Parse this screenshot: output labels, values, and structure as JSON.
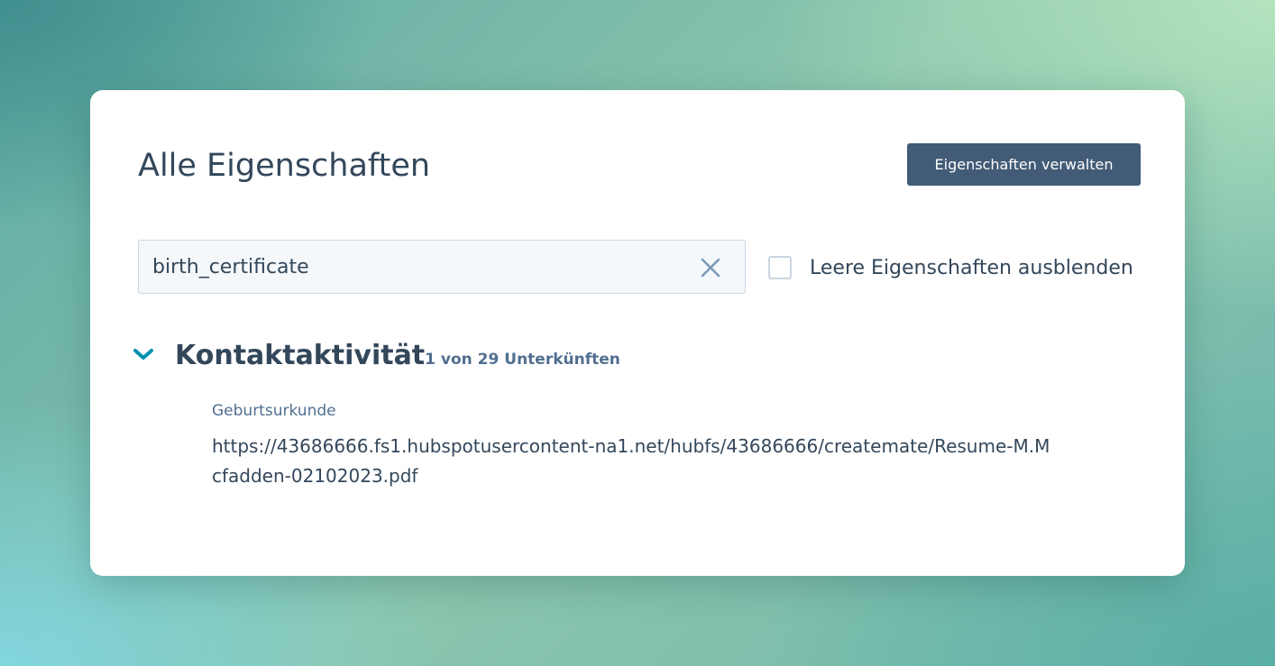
{
  "panel": {
    "title": "Alle Eigenschaften",
    "manage_button_label": "Eigenschaften verwalten"
  },
  "search": {
    "value": "birth_certificate",
    "clear_icon": "close-x-icon"
  },
  "filters": {
    "hide_empty_label": "Leere Eigenschaften ausblenden",
    "hide_empty_checked": false
  },
  "section": {
    "chevron_icon": "chevron-down-icon",
    "title": "Kontaktaktivität",
    "count": "1 von 29 Unterkünften",
    "properties": [
      {
        "label": "Geburtsurkunde",
        "value": "https://43686666.fs1.hubspotusercontent-na1.net/hubfs/43686666/createmate/Resume-M.Mcfadden-02102023.pdf"
      }
    ]
  },
  "colors": {
    "text_primary": "#33475b",
    "text_secondary": "#516f90",
    "button_bg": "#425b76",
    "accent": "#0091ae"
  }
}
